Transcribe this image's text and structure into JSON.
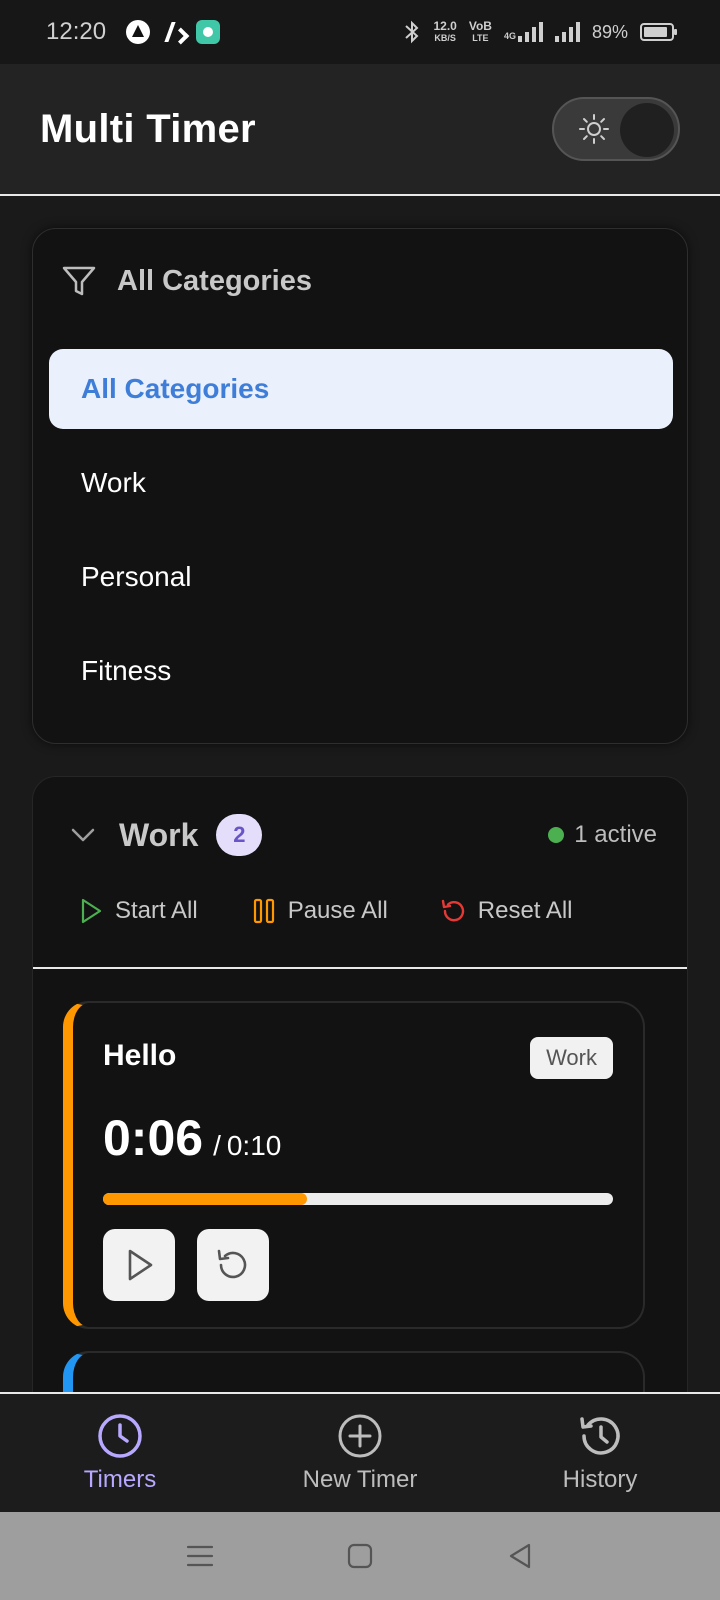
{
  "status_bar": {
    "time": "12:20",
    "net_speed_top": "12.0",
    "net_speed_bottom": "KB/S",
    "volte_top": "VoB",
    "volte_bottom": "LTE",
    "network_label": "4G",
    "battery": "89%"
  },
  "header": {
    "title": "Multi Timer",
    "theme_icon": "sun-icon"
  },
  "category_filter": {
    "label": "All Categories",
    "options": [
      "All Categories",
      "Work",
      "Personal",
      "Fitness"
    ],
    "selected": "All Categories"
  },
  "group": {
    "title": "Work",
    "count": "2",
    "active_text": "1 active",
    "actions": {
      "start_all": "Start All",
      "pause_all": "Pause All",
      "reset_all": "Reset All"
    }
  },
  "timers": [
    {
      "name": "Hello",
      "tag": "Work",
      "current": "0:06",
      "separator": "/",
      "total": "0:10",
      "progress": 0.4,
      "accent": "#ff9800"
    }
  ],
  "bottom_nav": {
    "timers": "Timers",
    "new_timer": "New Timer",
    "history": "History"
  },
  "colors": {
    "accent_orange": "#ff9800",
    "accent_purple": "#b8a8ff",
    "selected_blue": "#3f7ed8",
    "active_green": "#4caf50",
    "second_timer_accent": "#2196f3"
  }
}
